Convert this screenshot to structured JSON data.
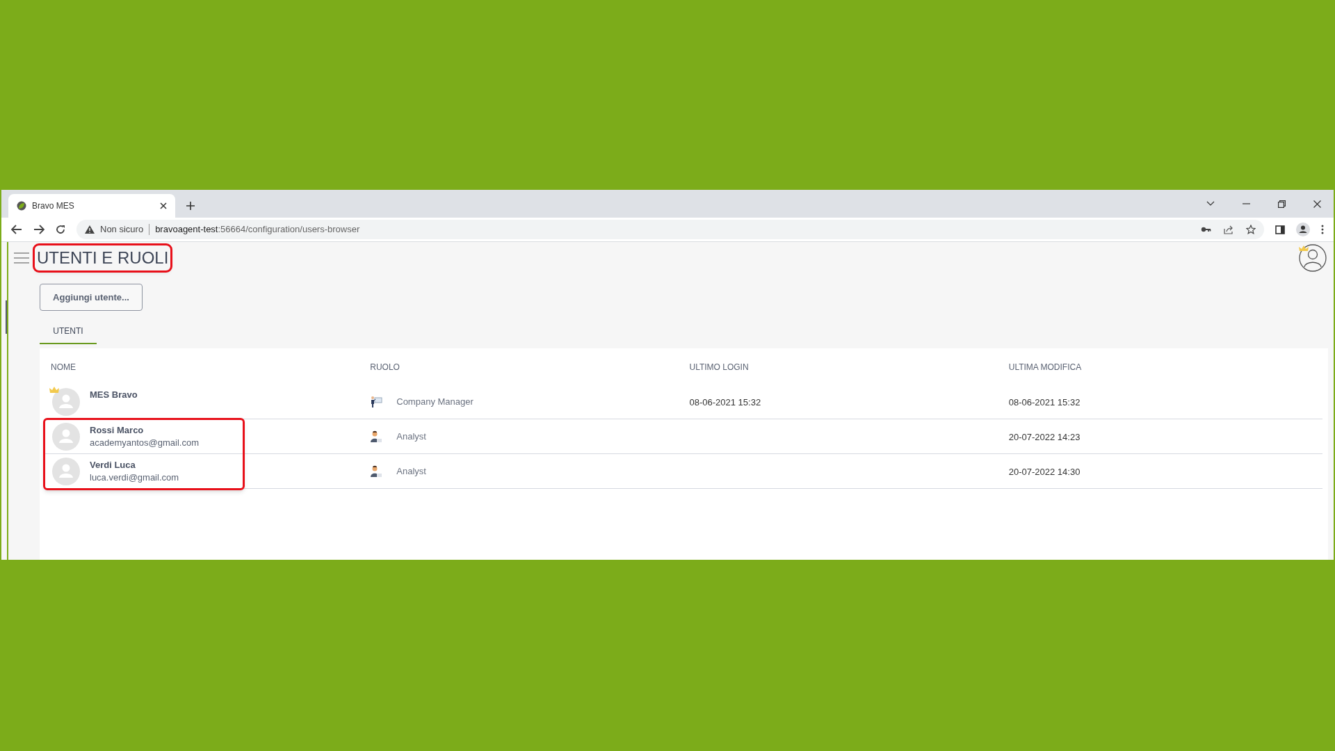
{
  "browser": {
    "tab_title": "Bravo MES",
    "security": "Non sicuro",
    "url_host": "bravoagent-test",
    "url_path": ":56664/configuration/users-browser"
  },
  "page": {
    "title": "UTENTI E RUOLI",
    "title_highlighted": true,
    "add_button": "Aggiungi utente...",
    "tabs": [
      {
        "label": "UTENTI",
        "selected": true
      }
    ]
  },
  "table": {
    "columns": [
      "NOME",
      "RUOLO",
      "ULTIMO LOGIN",
      "ULTIMA MODIFICA"
    ],
    "rows": [
      {
        "name": "MES Bravo",
        "email": null,
        "admin": true,
        "role": "Company Manager",
        "kind": "manager",
        "last_login": "08-06-2021 15:32",
        "last_modified": "08-06-2021 15:32",
        "highlighted": false
      },
      {
        "name": "Rossi Marco",
        "email": "academyantos@gmail.com",
        "admin": false,
        "role": "Analyst",
        "kind": "analyst",
        "last_login": null,
        "last_modified": "20-07-2022 14:23",
        "highlighted": true
      },
      {
        "name": "Verdi Luca",
        "email": "luca.verdi@gmail.com",
        "admin": false,
        "role": "Analyst",
        "kind": "analyst",
        "last_login": null,
        "last_modified": "20-07-2022 14:30",
        "highlighted": true
      }
    ]
  }
}
